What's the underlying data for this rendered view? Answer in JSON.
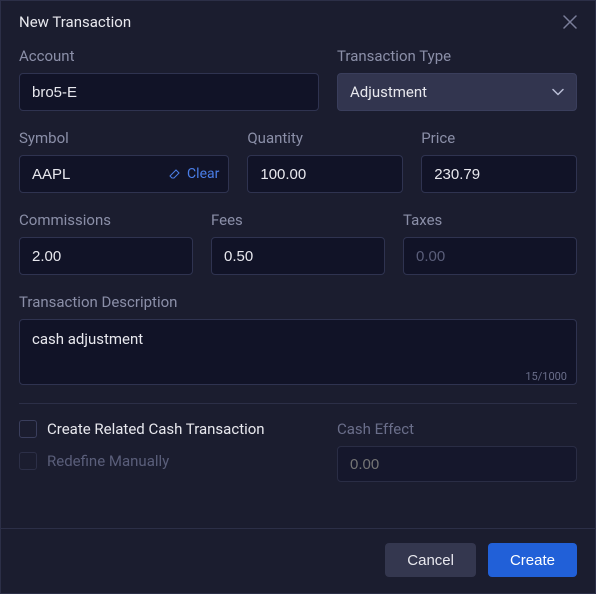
{
  "title": "New Transaction",
  "fields": {
    "account": {
      "label": "Account",
      "value": "bro5-E"
    },
    "transaction_type": {
      "label": "Transaction Type",
      "value": "Adjustment"
    },
    "symbol": {
      "label": "Symbol",
      "value": "AAPL",
      "clear_label": "Clear"
    },
    "quantity": {
      "label": "Quantity",
      "value": "100.00"
    },
    "price": {
      "label": "Price",
      "value": "230.79"
    },
    "commissions": {
      "label": "Commissions",
      "value": "2.00"
    },
    "fees": {
      "label": "Fees",
      "value": "0.50"
    },
    "taxes": {
      "label": "Taxes",
      "placeholder": "0.00"
    },
    "description": {
      "label": "Transaction Description",
      "value": "cash adjustment",
      "counter": "15/1000"
    }
  },
  "options": {
    "create_related": {
      "label": "Create Related Cash Transaction",
      "checked": false
    },
    "redefine_manually": {
      "label": "Redefine Manually",
      "checked": false,
      "disabled": true
    },
    "cash_effect": {
      "label": "Cash Effect",
      "placeholder": "0.00"
    }
  },
  "footer": {
    "cancel": "Cancel",
    "create": "Create"
  }
}
